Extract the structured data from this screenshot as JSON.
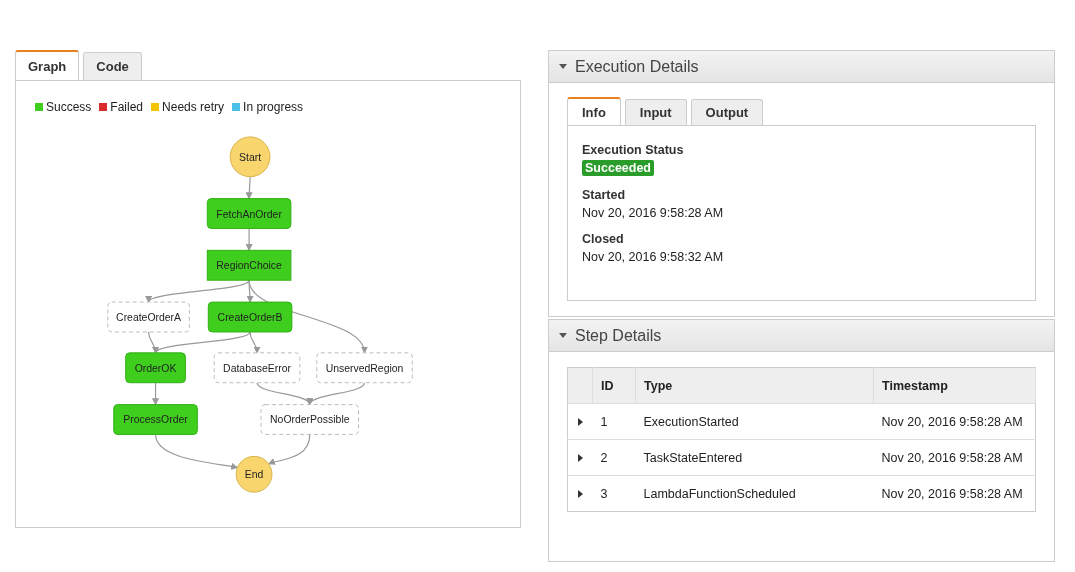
{
  "graph_tabs": [
    {
      "label": "Graph",
      "selected": true
    },
    {
      "label": "Code",
      "selected": false
    }
  ],
  "legend": [
    {
      "label": "Success",
      "color": "#3fce1d"
    },
    {
      "label": "Failed",
      "color": "#d92b2b"
    },
    {
      "label": "Needs retry",
      "color": "#f5c400"
    },
    {
      "label": "In progress",
      "color": "#4cc0e8"
    }
  ],
  "nodes": [
    {
      "label": "Start",
      "kind": "terminal"
    },
    {
      "label": "FetchAnOrder",
      "kind": "task",
      "succeeded": true
    },
    {
      "label": "RegionChoice",
      "kind": "choice",
      "succeeded": true
    },
    {
      "label": "CreateOrderA",
      "kind": "task",
      "succeeded": false
    },
    {
      "label": "CreateOrderB",
      "kind": "task",
      "succeeded": true
    },
    {
      "label": "OrderOK",
      "kind": "task",
      "succeeded": true
    },
    {
      "label": "DatabaseError",
      "kind": "task",
      "succeeded": false
    },
    {
      "label": "UnservedRegion",
      "kind": "task",
      "succeeded": false
    },
    {
      "label": "ProcessOrder",
      "kind": "task",
      "succeeded": true
    },
    {
      "label": "NoOrderPossible",
      "kind": "task",
      "succeeded": false
    },
    {
      "label": "End",
      "kind": "terminal"
    }
  ],
  "execution_details": {
    "title": "Execution Details",
    "expanded": true,
    "tabs": [
      {
        "label": "Info",
        "selected": true
      },
      {
        "label": "Input",
        "selected": false
      },
      {
        "label": "Output",
        "selected": false
      }
    ],
    "status_label": "Execution Status",
    "status": "Succeeded",
    "fields": [
      {
        "label": "Started",
        "value": "Nov 20, 2016 9:58:28 AM"
      },
      {
        "label": "Closed",
        "value": "Nov 20, 2016 9:58:32 AM"
      }
    ]
  },
  "step_details": {
    "title": "Step Details",
    "expanded": true,
    "columns": [
      "ID",
      "Type",
      "Timestamp"
    ],
    "rows": [
      {
        "id": "1",
        "type": "ExecutionStarted",
        "timestamp": "Nov 20, 2016 9:58:28 AM",
        "expanded": false
      },
      {
        "id": "2",
        "type": "TaskStateEntered",
        "timestamp": "Nov 20, 2016 9:58:28 AM",
        "expanded": false
      },
      {
        "id": "3",
        "type": "LambdaFunctionScheduled",
        "timestamp": "Nov 20, 2016 9:58:28 AM",
        "expanded": false
      }
    ]
  }
}
